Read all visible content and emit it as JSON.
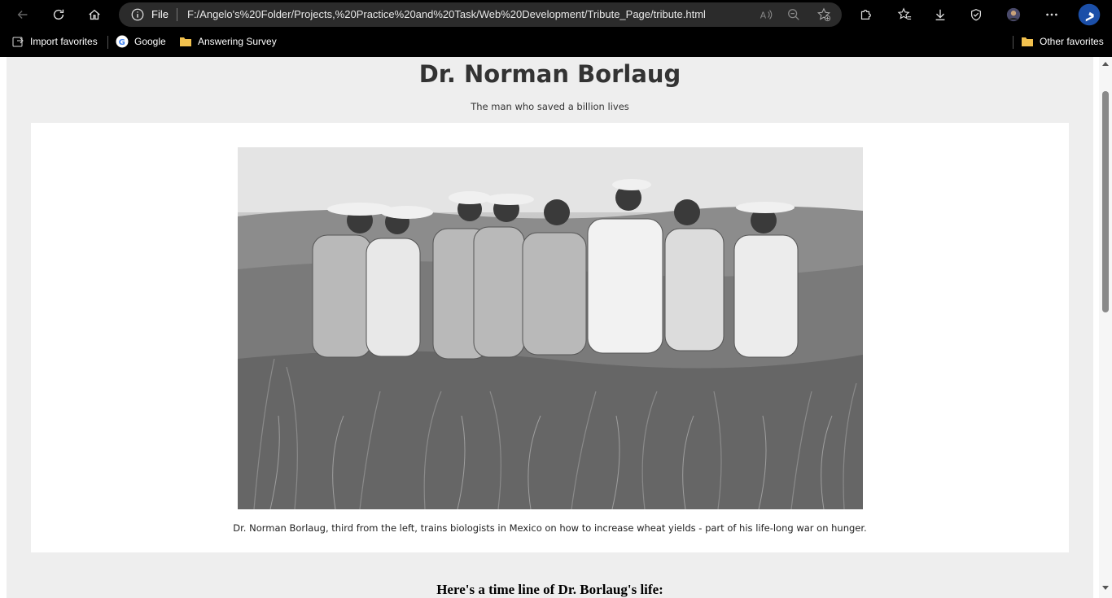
{
  "browser": {
    "address_prefix": "File",
    "url": "F:/Angelo's%20Folder/Projects,%20Practice%20and%20Task/Web%20Development/Tribute_Page/tribute.html",
    "bookmarks": [
      {
        "label": "Import favorites"
      },
      {
        "label": "Google"
      },
      {
        "label": "Answering Survey"
      }
    ],
    "other_favorites": "Other favorites"
  },
  "page": {
    "title": "Dr. Norman Borlaug",
    "subtitle": "The man who saved a billion lives",
    "image_caption": "Dr. Norman Borlaug, third from the left, trains biologists in Mexico on how to increase wheat yields - part of his life-long war on hunger.",
    "timeline_heading": "Here's a time line of Dr. Borlaug's life:"
  }
}
